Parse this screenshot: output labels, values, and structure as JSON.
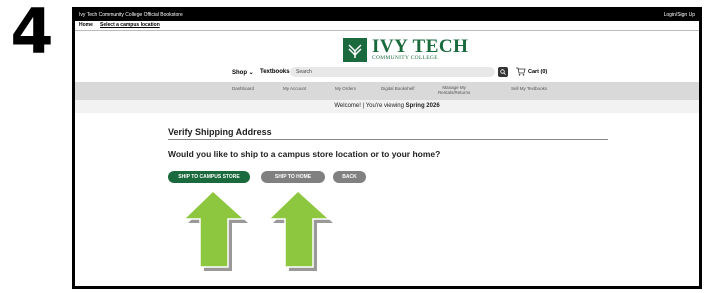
{
  "step_number": "4",
  "topbar": {
    "store_name": "Ivy Tech Community College Official Bookstore",
    "login_label": "Login/Sign Up"
  },
  "crumbbar": {
    "home": "Home",
    "select_campus": "Select a campus location"
  },
  "logo": {
    "name": "IVY TECH",
    "subtitle": "COMMUNITY COLLEGE"
  },
  "shopbar": {
    "shop_label": "Shop",
    "textbooks_label": "Textbooks",
    "search_placeholder": "Search",
    "cart_label": "Cart (0)"
  },
  "nav": {
    "items": [
      "Dashboard",
      "My Account",
      "My Orders",
      "Digital Bookshelf",
      "Manage My",
      "Rentals/Returns",
      "Sell My Textbooks"
    ]
  },
  "welcome": {
    "prefix": "Welcome! | You're viewing ",
    "term": "Spring 2026"
  },
  "main": {
    "title": "Verify Shipping Address",
    "question": "Would you like to ship to a campus store location or to your home?",
    "btn_campus": "SHIP TO CAMPUS STORE",
    "btn_home": "SHIP TO HOME",
    "btn_back": "BACK"
  },
  "colors": {
    "brand_green": "#1b6a3d",
    "arrow_green": "#8dc63f",
    "button_gray": "#808080"
  }
}
